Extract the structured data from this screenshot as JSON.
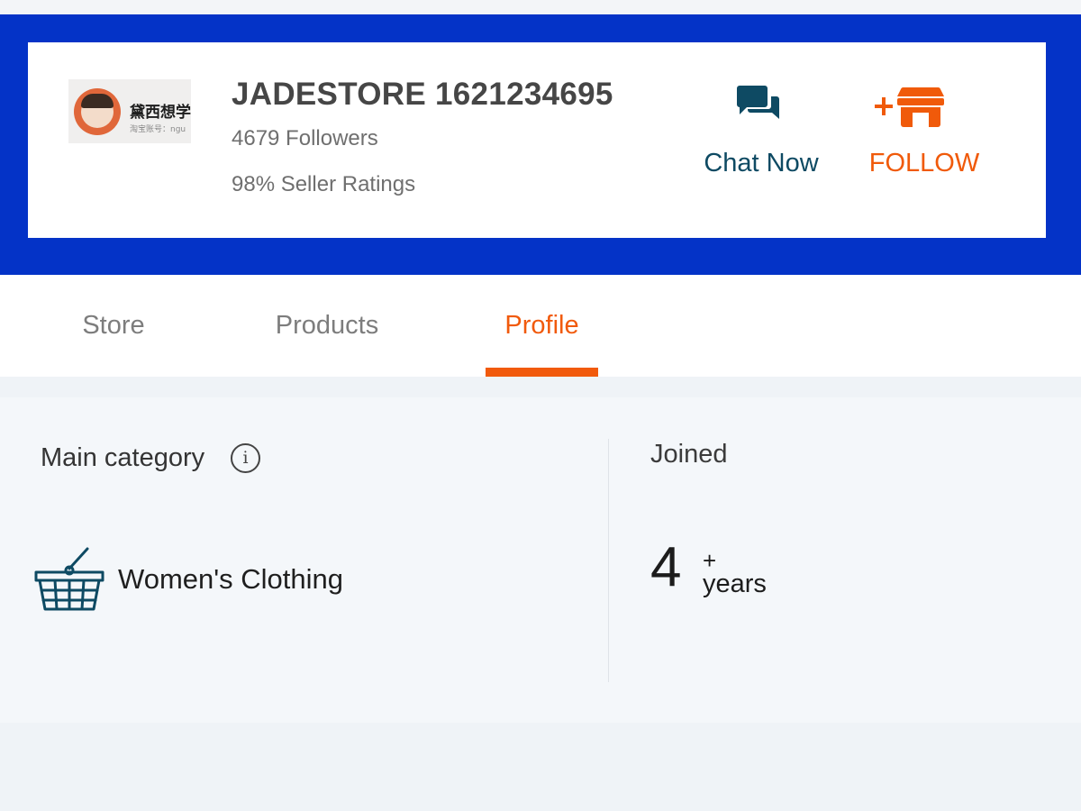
{
  "header": {
    "logo": {
      "title_text": "黛西想学",
      "subtitle_text": "淘宝账号：ngu"
    },
    "store_name": "JADESTORE 1621234695",
    "followers": "4679 Followers",
    "seller_ratings": "98% Seller Ratings",
    "chat_label": "Chat Now",
    "follow_label": "FOLLOW",
    "chat_icon": "chat-bubbles-icon",
    "follow_icon": "add-store-icon"
  },
  "tabs": [
    {
      "label": "Store",
      "active": false
    },
    {
      "label": "Products",
      "active": false
    },
    {
      "label": "Profile",
      "active": true
    }
  ],
  "profile": {
    "main_category_label": "Main category",
    "info_icon": "info-icon",
    "category_icon": "basket-icon",
    "category_value": "Women's Clothing",
    "joined_label": "Joined",
    "joined_number": "4",
    "joined_plus": "+",
    "joined_unit": "years"
  },
  "colors": {
    "banner": "#0433c7",
    "accent": "#f15a0c",
    "chat": "#0e4a63"
  }
}
